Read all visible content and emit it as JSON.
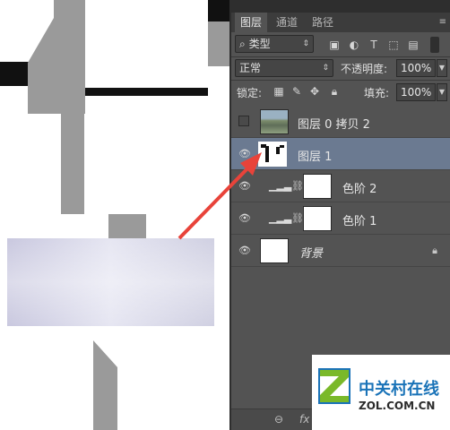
{
  "panel": {
    "tabs": [
      "图层",
      "通道",
      "路径"
    ],
    "menu_icon": "hamburger-menu-icon",
    "filter": {
      "kind_label": "类型"
    },
    "blend": {
      "mode": "正常",
      "opacity_label": "不透明度:",
      "opacity_value": "100%"
    },
    "lock": {
      "label": "锁定:",
      "fill_label": "填充:",
      "fill_value": "100%"
    },
    "layers": [
      {
        "name": "图层 0 拷贝 2",
        "visible": false,
        "thumb": "photo"
      },
      {
        "name": "图层 1",
        "visible": true,
        "selected": true,
        "thumb": "mask-shape"
      },
      {
        "name": "色阶 2",
        "visible": true,
        "type": "adjustment"
      },
      {
        "name": "色阶 1",
        "visible": true,
        "type": "adjustment"
      },
      {
        "name": "背景",
        "visible": true,
        "locked": true
      }
    ],
    "bottom": {
      "link_icon": "link-icon",
      "fx_label": "fx"
    }
  },
  "watermark": {
    "brand_cn": "中关村在线",
    "brand_en": "ZOL.COM.CN"
  },
  "colors": {
    "arrow": "#e8433a",
    "selected_row": "#6b7a91",
    "panel_bg": "#535353",
    "logo_green": "#7ab929",
    "logo_blue": "#1a73b8"
  }
}
